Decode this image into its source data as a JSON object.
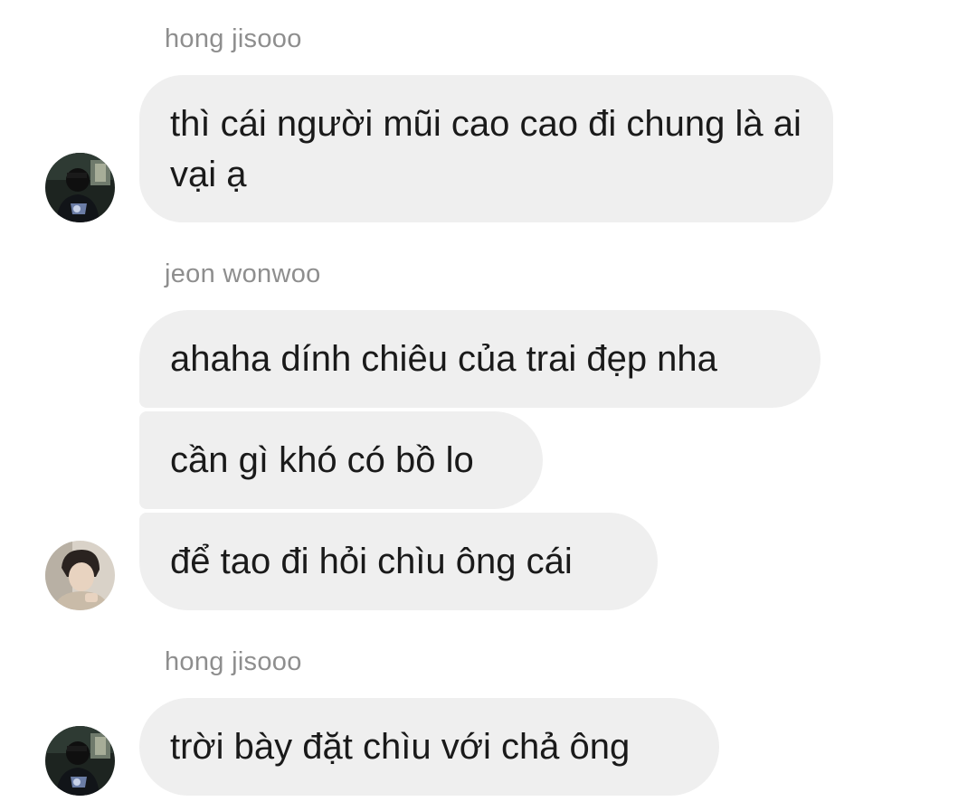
{
  "groups": [
    {
      "sender": "hong jisooo",
      "messages": [
        "thì cái người mũi cao cao đi chung là ai vại ạ"
      ],
      "avatar_icon": "profile-photo-icon"
    },
    {
      "sender": "jeon wonwoo",
      "messages": [
        "ahaha dính chiêu của trai đẹp nha",
        "cần gì khó có bồ lo",
        "để tao đi hỏi chìu ông cái"
      ],
      "avatar_icon": "profile-photo-icon"
    },
    {
      "sender": "hong jisooo",
      "messages": [
        "trời bày đặt chìu với chả ông"
      ],
      "avatar_icon": "profile-photo-icon"
    }
  ],
  "colors": {
    "bubble_background": "#efefef",
    "sender_name": "#8e8e8e",
    "message_text": "#1a1a1a"
  }
}
